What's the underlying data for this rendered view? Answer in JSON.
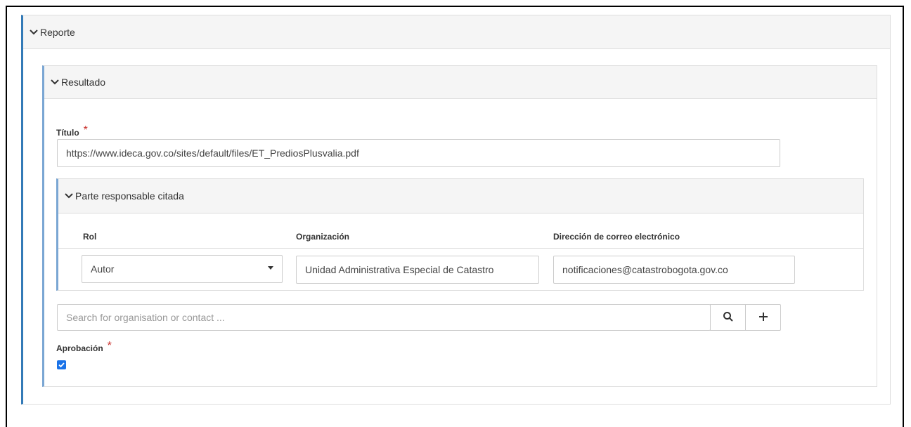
{
  "reporte": {
    "title": "Reporte"
  },
  "resultado": {
    "title": "Resultado",
    "titulo": {
      "label": "Título",
      "required": "*",
      "value": "https://www.ideca.gov.co/sites/default/files/ET_PrediosPlusvalia.pdf"
    },
    "parte": {
      "title": "Parte responsable citada",
      "columns": [
        "Rol",
        "Organización",
        "Dirección de correo electrónico"
      ],
      "rol_value": "Autor",
      "organizacion_value": "Unidad Administrativa Especial de Catastro",
      "email_value": "notificaciones@catastrobogota.gov.co"
    },
    "search": {
      "placeholder": "Search for organisation or contact ..."
    },
    "aprobacion": {
      "label": "Aprobación",
      "required": "*",
      "checked": true
    }
  },
  "icons": {
    "chevron": "chevron-down-icon",
    "search": "search-icon",
    "add": "plus-icon",
    "dropdown": "caret-down-icon",
    "check": "check-icon"
  },
  "colors": {
    "accent": "#337ab7",
    "inner_accent": "#7aa6d3",
    "required": "#c9302c",
    "checkbox": "#1a73e8"
  }
}
